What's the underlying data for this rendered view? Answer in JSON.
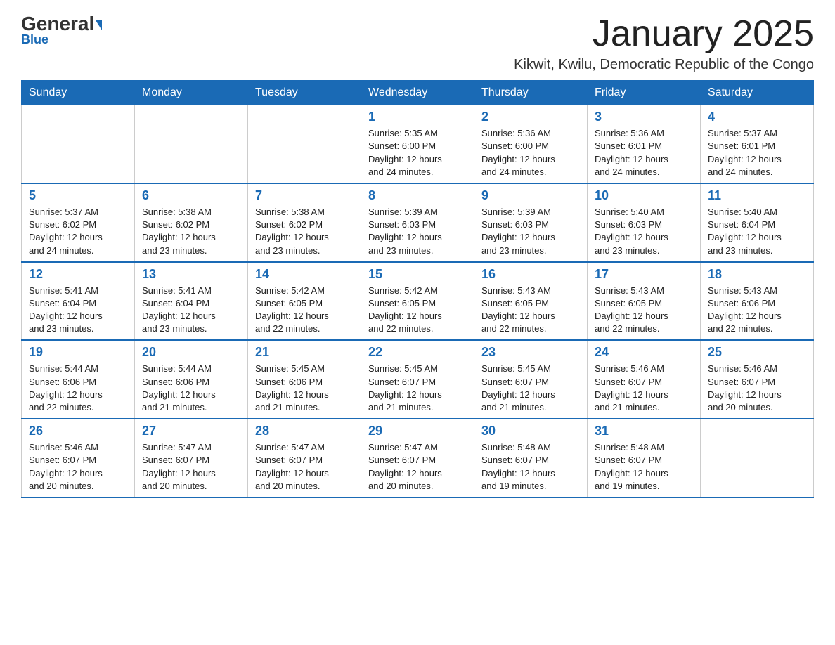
{
  "header": {
    "logo_general": "General",
    "logo_blue": "Blue",
    "month_title": "January 2025",
    "location": "Kikwit, Kwilu, Democratic Republic of the Congo"
  },
  "weekdays": [
    "Sunday",
    "Monday",
    "Tuesday",
    "Wednesday",
    "Thursday",
    "Friday",
    "Saturday"
  ],
  "weeks": [
    [
      {
        "day": "",
        "info": ""
      },
      {
        "day": "",
        "info": ""
      },
      {
        "day": "",
        "info": ""
      },
      {
        "day": "1",
        "info": "Sunrise: 5:35 AM\nSunset: 6:00 PM\nDaylight: 12 hours\nand 24 minutes."
      },
      {
        "day": "2",
        "info": "Sunrise: 5:36 AM\nSunset: 6:00 PM\nDaylight: 12 hours\nand 24 minutes."
      },
      {
        "day": "3",
        "info": "Sunrise: 5:36 AM\nSunset: 6:01 PM\nDaylight: 12 hours\nand 24 minutes."
      },
      {
        "day": "4",
        "info": "Sunrise: 5:37 AM\nSunset: 6:01 PM\nDaylight: 12 hours\nand 24 minutes."
      }
    ],
    [
      {
        "day": "5",
        "info": "Sunrise: 5:37 AM\nSunset: 6:02 PM\nDaylight: 12 hours\nand 24 minutes."
      },
      {
        "day": "6",
        "info": "Sunrise: 5:38 AM\nSunset: 6:02 PM\nDaylight: 12 hours\nand 23 minutes."
      },
      {
        "day": "7",
        "info": "Sunrise: 5:38 AM\nSunset: 6:02 PM\nDaylight: 12 hours\nand 23 minutes."
      },
      {
        "day": "8",
        "info": "Sunrise: 5:39 AM\nSunset: 6:03 PM\nDaylight: 12 hours\nand 23 minutes."
      },
      {
        "day": "9",
        "info": "Sunrise: 5:39 AM\nSunset: 6:03 PM\nDaylight: 12 hours\nand 23 minutes."
      },
      {
        "day": "10",
        "info": "Sunrise: 5:40 AM\nSunset: 6:03 PM\nDaylight: 12 hours\nand 23 minutes."
      },
      {
        "day": "11",
        "info": "Sunrise: 5:40 AM\nSunset: 6:04 PM\nDaylight: 12 hours\nand 23 minutes."
      }
    ],
    [
      {
        "day": "12",
        "info": "Sunrise: 5:41 AM\nSunset: 6:04 PM\nDaylight: 12 hours\nand 23 minutes."
      },
      {
        "day": "13",
        "info": "Sunrise: 5:41 AM\nSunset: 6:04 PM\nDaylight: 12 hours\nand 23 minutes."
      },
      {
        "day": "14",
        "info": "Sunrise: 5:42 AM\nSunset: 6:05 PM\nDaylight: 12 hours\nand 22 minutes."
      },
      {
        "day": "15",
        "info": "Sunrise: 5:42 AM\nSunset: 6:05 PM\nDaylight: 12 hours\nand 22 minutes."
      },
      {
        "day": "16",
        "info": "Sunrise: 5:43 AM\nSunset: 6:05 PM\nDaylight: 12 hours\nand 22 minutes."
      },
      {
        "day": "17",
        "info": "Sunrise: 5:43 AM\nSunset: 6:05 PM\nDaylight: 12 hours\nand 22 minutes."
      },
      {
        "day": "18",
        "info": "Sunrise: 5:43 AM\nSunset: 6:06 PM\nDaylight: 12 hours\nand 22 minutes."
      }
    ],
    [
      {
        "day": "19",
        "info": "Sunrise: 5:44 AM\nSunset: 6:06 PM\nDaylight: 12 hours\nand 22 minutes."
      },
      {
        "day": "20",
        "info": "Sunrise: 5:44 AM\nSunset: 6:06 PM\nDaylight: 12 hours\nand 21 minutes."
      },
      {
        "day": "21",
        "info": "Sunrise: 5:45 AM\nSunset: 6:06 PM\nDaylight: 12 hours\nand 21 minutes."
      },
      {
        "day": "22",
        "info": "Sunrise: 5:45 AM\nSunset: 6:07 PM\nDaylight: 12 hours\nand 21 minutes."
      },
      {
        "day": "23",
        "info": "Sunrise: 5:45 AM\nSunset: 6:07 PM\nDaylight: 12 hours\nand 21 minutes."
      },
      {
        "day": "24",
        "info": "Sunrise: 5:46 AM\nSunset: 6:07 PM\nDaylight: 12 hours\nand 21 minutes."
      },
      {
        "day": "25",
        "info": "Sunrise: 5:46 AM\nSunset: 6:07 PM\nDaylight: 12 hours\nand 20 minutes."
      }
    ],
    [
      {
        "day": "26",
        "info": "Sunrise: 5:46 AM\nSunset: 6:07 PM\nDaylight: 12 hours\nand 20 minutes."
      },
      {
        "day": "27",
        "info": "Sunrise: 5:47 AM\nSunset: 6:07 PM\nDaylight: 12 hours\nand 20 minutes."
      },
      {
        "day": "28",
        "info": "Sunrise: 5:47 AM\nSunset: 6:07 PM\nDaylight: 12 hours\nand 20 minutes."
      },
      {
        "day": "29",
        "info": "Sunrise: 5:47 AM\nSunset: 6:07 PM\nDaylight: 12 hours\nand 20 minutes."
      },
      {
        "day": "30",
        "info": "Sunrise: 5:48 AM\nSunset: 6:07 PM\nDaylight: 12 hours\nand 19 minutes."
      },
      {
        "day": "31",
        "info": "Sunrise: 5:48 AM\nSunset: 6:07 PM\nDaylight: 12 hours\nand 19 minutes."
      },
      {
        "day": "",
        "info": ""
      }
    ]
  ]
}
